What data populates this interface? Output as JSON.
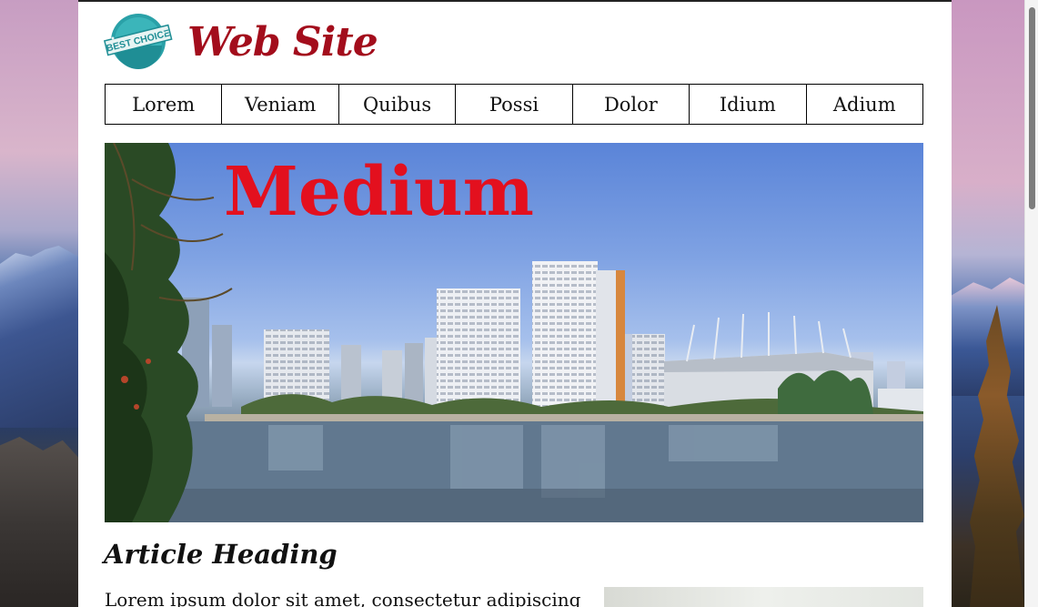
{
  "header": {
    "logo_text": "BEST CHOICE",
    "site_title": "Web Site"
  },
  "nav": {
    "items": [
      "Lorem",
      "Veniam",
      "Quibus",
      "Possi",
      "Dolor",
      "Idium",
      "Adium"
    ]
  },
  "hero": {
    "title": "Medium"
  },
  "article": {
    "heading": "Article Heading",
    "text": "Lorem ipsum dolor sit amet, consectetur adipiscing"
  },
  "colors": {
    "title_red": "#a30d1c",
    "hero_text_red": "#e3101e",
    "logo_teal": "#2aa1a8"
  }
}
